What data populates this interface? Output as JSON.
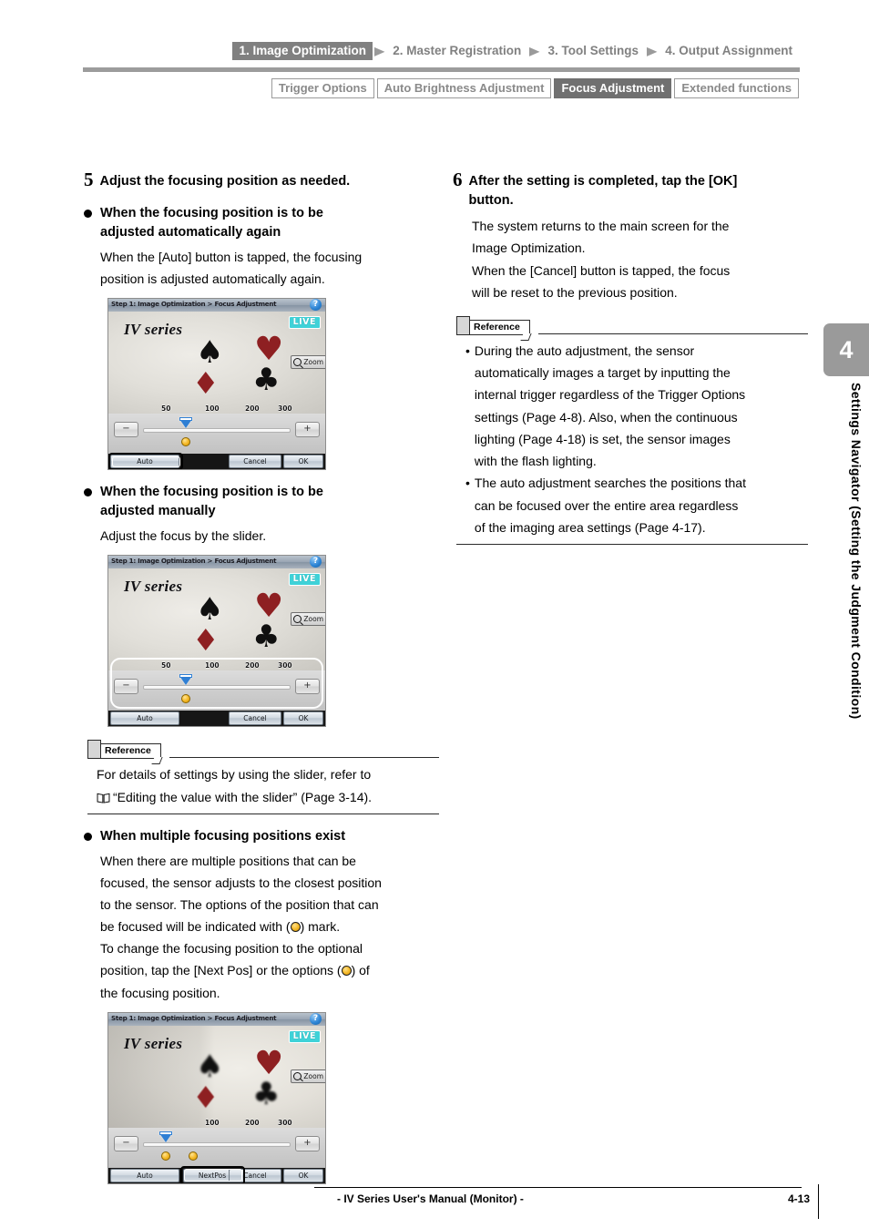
{
  "header": {
    "breadcrumbs": [
      {
        "label": "1. Image Optimization",
        "active": true
      },
      {
        "label": "2. Master Registration",
        "active": false
      },
      {
        "label": "3. Tool Settings",
        "active": false
      },
      {
        "label": "4. Output Assignment",
        "active": false
      }
    ],
    "arrow": "▶",
    "subtabs": [
      {
        "label": "Trigger Options",
        "active": false
      },
      {
        "label": "Auto Brightness Adjustment",
        "active": false
      },
      {
        "label": "Focus Adjustment",
        "active": true
      },
      {
        "label": "Extended functions",
        "active": false
      }
    ]
  },
  "left_column": {
    "step5": {
      "number": "5",
      "title": "Adjust the focusing position as needed."
    },
    "bullet_auto": {
      "heading_line1": "When the focusing position is to be",
      "heading_line2": "adjusted automatically again",
      "body_line1": "When the [Auto] button is tapped, the focusing",
      "body_line2": "position is adjusted automatically again."
    },
    "bullet_manual": {
      "heading_line1": "When the focusing position is to be",
      "heading_line2": "adjusted manually",
      "body_line1": "Adjust the focus by the slider."
    },
    "reference_slider": {
      "tab_label": "Reference",
      "line1": "For details of settings by using the slider, refer to",
      "line2_quote": "“Editing the value with the slider” (Page 3-14)."
    },
    "bullet_multiple": {
      "heading": "When multiple focusing positions exist",
      "body_line1": "When there are multiple positions that can be",
      "body_line2": "focused, the sensor adjusts to the closest position",
      "body_line3": "to the sensor. The options of the position that can",
      "body_line4_a": "be focused will be indicated with (",
      "body_line4_b": ") mark.",
      "body_line5": "To change the focusing position to the optional",
      "body_line6_a": "position, tap the [Next Pos] or the options (",
      "body_line6_b": ") of",
      "body_line7": "the focusing position."
    }
  },
  "right_column": {
    "step6": {
      "number": "6",
      "title_line1": "After the setting is completed, tap the [OK]",
      "title_line2": "button.",
      "body_line1": "The system returns to the main screen for the",
      "body_line2": "Image Optimization.",
      "body_line3": "When the [Cancel] button is tapped, the focus",
      "body_line4": "will be reset to the previous position."
    },
    "reference_auto": {
      "tab_label": "Reference",
      "bullet": "•",
      "item1_line1": "During the auto adjustment, the sensor",
      "item1_line2": "automatically images a target by inputting the",
      "item1_line3": "internal trigger regardless of the Trigger Options",
      "item1_line4": "settings (Page 4-8). Also, when the continuous",
      "item1_line5": "lighting (Page 4-18) is set, the sensor images",
      "item1_line6": "with the flash lighting.",
      "item2_line1": "The auto adjustment searches the positions that",
      "item2_line2": "can be focused over the entire area regardless",
      "item2_line3": "of the imaging area settings (Page 4-17)."
    }
  },
  "device_screens": {
    "common": {
      "title": "Step 1: Image Optimization > Focus Adjustment",
      "help_icon": "?",
      "live_badge": "LIVE",
      "zoom_button": "Zoom",
      "logo": "IV series",
      "minus_label": "−",
      "plus_label": "+",
      "btn_auto": "Auto",
      "btn_cancel": "Cancel",
      "btn_ok": "OK",
      "btn_nextpos": "NextPos",
      "suit_spade": "♠",
      "suit_heart": "♥",
      "suit_diamond": "♦",
      "suit_club": "♣"
    },
    "screen1": {
      "ticks": [
        "50",
        "100",
        "200",
        "300"
      ],
      "highlighted_control": "Auto"
    },
    "screen2": {
      "ticks": [
        "50",
        "100",
        "200",
        "300"
      ],
      "highlighted_control": "slider"
    },
    "screen3": {
      "ticks": [
        "100",
        "200",
        "300"
      ],
      "highlighted_control": "NextPos"
    }
  },
  "chapter_tab": {
    "number": "4",
    "text": "Settings Navigator (Setting the Judgment Condition)"
  },
  "footer": {
    "manual_title": "- IV Series User's Manual (Monitor) -",
    "page_number": "4-13"
  },
  "colors": {
    "nav_active_bg": "#808080",
    "subtab_active_bg": "#707070",
    "chapter_tab_bg": "#9a9a9a",
    "live_badge": "#3fd2d8",
    "slider_handle": "#2f7fd4",
    "position_dot": "#f6bb2b",
    "heart_red": "#8e2022"
  }
}
